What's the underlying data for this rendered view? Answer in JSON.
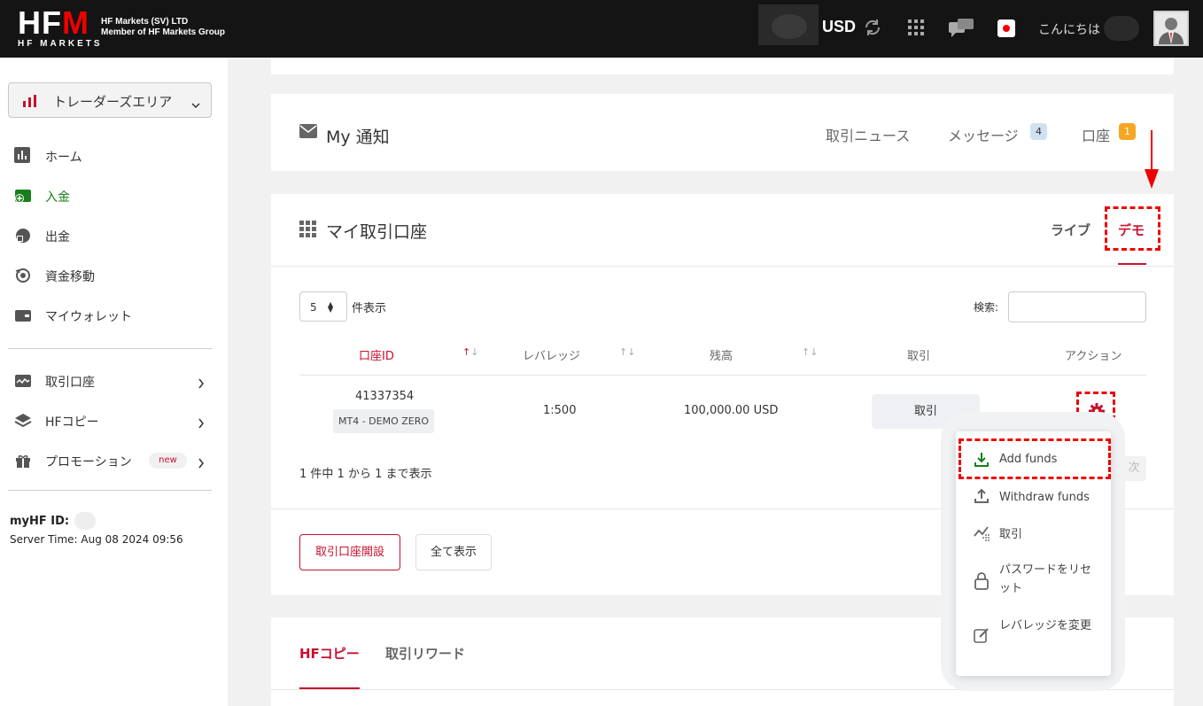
{
  "topbar": {
    "logo_main": "HFM",
    "logo_sub": "HF MARKETS",
    "company_line1": "HF Markets (SV) LTD",
    "company_line2": "Member of HF Markets Group",
    "currency": "USD",
    "greeting": "こんにちは"
  },
  "sidebar": {
    "area_selector": "トレーダーズエリア",
    "items": [
      {
        "label": "ホーム",
        "icon": "chart-icon"
      },
      {
        "label": "入金",
        "icon": "deposit-icon",
        "active": true
      },
      {
        "label": "出金",
        "icon": "withdraw-icon"
      },
      {
        "label": "資金移動",
        "icon": "transfer-icon"
      },
      {
        "label": "マイウォレット",
        "icon": "wallet-icon"
      }
    ],
    "items2": [
      {
        "label": "取引口座",
        "icon": "accounts-icon"
      },
      {
        "label": "HFコピー",
        "icon": "layers-icon"
      },
      {
        "label": "プロモーション",
        "icon": "gift-icon",
        "badge": "new"
      }
    ],
    "myhf_label": "myHF ID:",
    "server_time": "Server Time: Aug 08 2024 09:56"
  },
  "notifications": {
    "title": "My 通知",
    "tabs": [
      {
        "label": "取引ニュース"
      },
      {
        "label": "メッセージ",
        "count": "4",
        "count_color": "#cfe2f3"
      },
      {
        "label": "口座",
        "count": "1",
        "count_color": "#f5a623"
      }
    ]
  },
  "accounts": {
    "title": "マイ取引口座",
    "tab_live": "ライブ",
    "tab_demo": "デモ",
    "page_size": "5",
    "show_label": "件表示",
    "search_label": "検索:",
    "columns": [
      "口座ID",
      "レバレッジ",
      "残高",
      "取引",
      "アクション"
    ],
    "rows": [
      {
        "account_id": "41337354",
        "type": "MT4 - DEMO ZERO",
        "leverage": "1:500",
        "balance": "100,000.00 USD",
        "trade_button": "取引"
      }
    ],
    "info": "1 件中 1 から 1 まで表示",
    "next": "次",
    "open_button": "取引口座開設",
    "show_all_button": "全て表示"
  },
  "action_menu": {
    "items": [
      {
        "label": "Add funds",
        "icon": "download-icon"
      },
      {
        "label": "Withdraw funds",
        "icon": "upload-icon"
      },
      {
        "label": "取引",
        "icon": "trade-icon"
      },
      {
        "label": "パスワードをリセット",
        "icon": "lock-icon"
      },
      {
        "label": "レバレッジを変更",
        "icon": "edit-icon"
      }
    ]
  },
  "bottom_tabs": {
    "copy": "HFコピー",
    "reward": "取引リワード"
  },
  "colors": {
    "brand_red": "#c8102e",
    "active_green": "#1a7f1a",
    "topbar": "#141414",
    "highlight": "#e00000"
  }
}
